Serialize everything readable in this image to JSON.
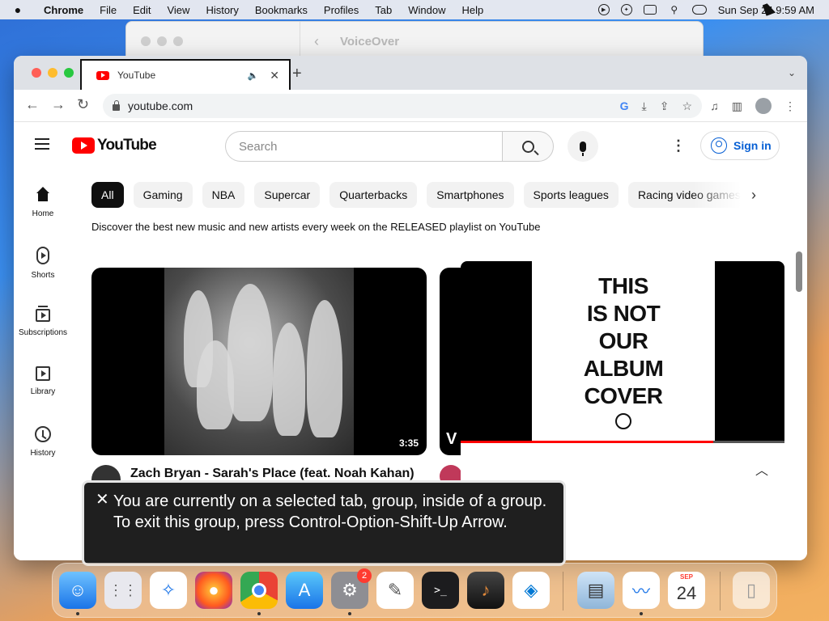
{
  "menubar": {
    "app_name": "Chrome",
    "items": [
      "File",
      "Edit",
      "View",
      "History",
      "Bookmarks",
      "Profiles",
      "Tab",
      "Window",
      "Help"
    ],
    "clock": "Sun Sep 24  9:59 AM"
  },
  "voiceover_window": {
    "title": "VoiceOver",
    "back_glyph": "‹"
  },
  "chrome": {
    "tab": {
      "title": "YouTube",
      "audio_glyph": "🔈",
      "close_glyph": "✕"
    },
    "new_tab_glyph": "+",
    "tab_search_glyph": "⌄",
    "url": "youtube.com",
    "back_glyph": "←",
    "forward_glyph": "→",
    "reload_glyph": "↻"
  },
  "youtube": {
    "logo_text": "YouTube",
    "search_placeholder": "Search",
    "signin_label": "Sign in",
    "kebab_glyph": "⋮",
    "nav": [
      {
        "label": "Home"
      },
      {
        "label": "Shorts"
      },
      {
        "label": "Subscriptions"
      },
      {
        "label": "Library"
      },
      {
        "label": "History"
      }
    ],
    "chips": [
      "All",
      "Gaming",
      "NBA",
      "Supercar",
      "Quarterbacks",
      "Smartphones",
      "Sports leagues",
      "Racing video games"
    ],
    "chip_next_glyph": "›",
    "promo_text": "Discover the best new music and new artists every week on the RELEASED playlist on YouTube",
    "video1": {
      "title": "Zach Bryan - Sarah's Place (feat. Noah Kahan)",
      "duration": "3:35"
    },
    "video2": {
      "logo_letter": "V"
    },
    "miniplayer": {
      "album_lines": [
        "THIS",
        "IS NOT",
        "OUR",
        "ALBUM",
        "COVER"
      ],
      "progress_fraction": 0.78,
      "chevron_glyph": "︿"
    }
  },
  "voiceover_caption": {
    "close_glyph": "✕",
    "text": "You are currently on a selected tab, group, inside of a group.  To exit this group, press Control-Option-Shift-Up Arrow."
  },
  "dock": {
    "settings_badge": "2",
    "calendar_month": "SEP",
    "calendar_day": "24",
    "terminal_prompt": ">_"
  },
  "colors": {
    "youtube_red": "#ff0000",
    "signin_blue": "#065fd4",
    "chrome_tabstrip": "#dee1e6"
  }
}
